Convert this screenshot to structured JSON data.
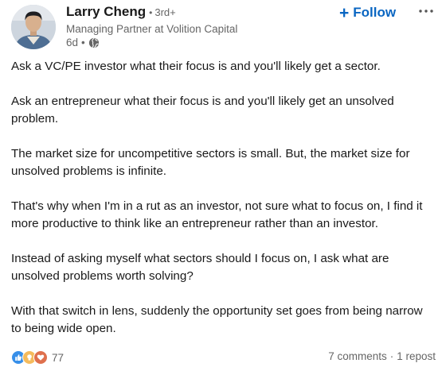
{
  "author": {
    "name": "Larry Cheng",
    "degree": "3rd+",
    "headline": "Managing Partner at Volition Capital",
    "time_ago": "6d",
    "visibility_icon": "globe-icon"
  },
  "actions": {
    "follow_label": "Follow",
    "follow_icon": "plus-icon",
    "menu_icon": "ellipsis-icon"
  },
  "post": {
    "paragraphs": [
      "Ask a VC/PE investor what their focus is and you'll likely get a sector.",
      "Ask an entrepreneur what their focus is and you'll likely get an unsolved problem.",
      "The market size for uncompetitive sectors is small. But, the market size for unsolved problems is infinite.",
      "That's why when I'm in a rut as an investor, not sure what to focus on, I find it more productive to think like an entrepreneur rather than an investor.",
      "Instead of asking myself what sectors should I focus on, I ask what are unsolved problems worth solving?",
      "With that switch in lens, suddenly the opportunity set goes from being narrow to being wide open."
    ]
  },
  "social": {
    "reaction_icons": [
      "like-icon",
      "insightful-icon",
      "love-icon"
    ],
    "reaction_count": "77",
    "comments": "7 comments",
    "separator": "·",
    "reposts": "1 repost"
  },
  "colors": {
    "accent": "#0a66c2",
    "muted_text": "#666666",
    "like": "#378fe9",
    "insightful": "#f5bb5c",
    "love": "#df704d"
  }
}
